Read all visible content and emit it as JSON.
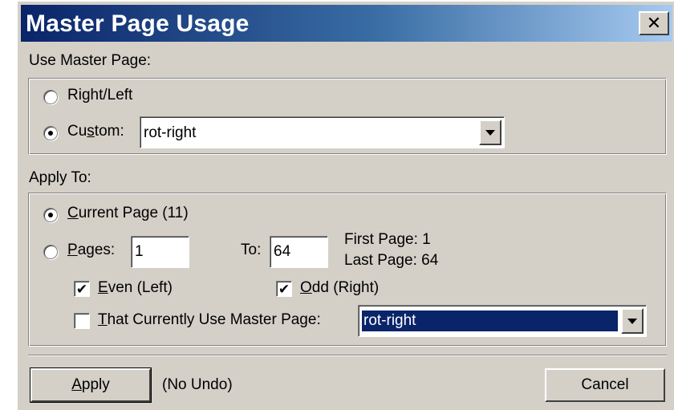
{
  "window": {
    "title": "Master Page Usage",
    "close_glyph": "✕"
  },
  "use_master_page": {
    "label": "Use Master Page:",
    "right_left_label": "Right/Left",
    "right_left_checked": false,
    "custom_label_pre": "Cu",
    "custom_label_u": "s",
    "custom_label_post": "tom:",
    "custom_checked": true,
    "custom_value": "rot-right"
  },
  "apply_to": {
    "label": "Apply To:",
    "current_page_u": "C",
    "current_page_rest": "urrent Page (11)",
    "current_page_checked": true,
    "pages_u": "P",
    "pages_rest": "ages:",
    "pages_checked": false,
    "pages_from": "1",
    "to_label": "To:",
    "pages_to": "64",
    "first_page_label": "First Page:",
    "first_page_value": "1",
    "last_page_label": "Last Page:",
    "last_page_value": "64",
    "even_u": "E",
    "even_rest": "ven (Left)",
    "even_checked": true,
    "odd_u": "O",
    "odd_rest": "dd (Right)",
    "odd_checked": true,
    "that_use_u": "T",
    "that_use_rest": "hat Currently Use Master Page:",
    "that_use_checked": false,
    "that_use_value": "rot-right"
  },
  "footer": {
    "apply_u": "A",
    "apply_rest": "pply",
    "no_undo": "(No Undo)",
    "cancel": "Cancel"
  },
  "check_glyph": "✔",
  "icons": {
    "close": "close-icon",
    "dropdown": "chevron-down-icon"
  },
  "colors": {
    "title_bar_start": "#0a246a",
    "title_bar_end": "#a6caf0",
    "dialog_bg": "#d4d0c8",
    "selection": "#0a246a"
  }
}
